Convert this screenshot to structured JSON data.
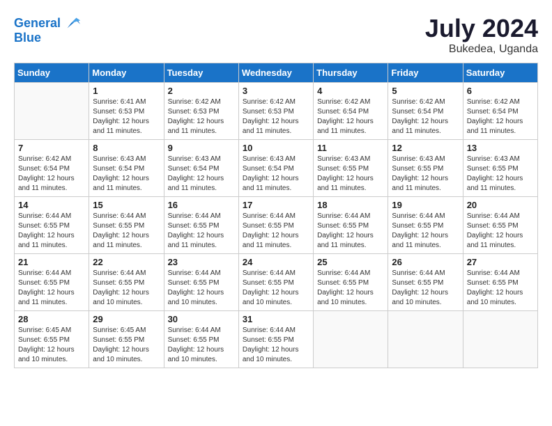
{
  "header": {
    "logo_line1": "General",
    "logo_line2": "Blue",
    "month_year": "July 2024",
    "location": "Bukedea, Uganda"
  },
  "weekdays": [
    "Sunday",
    "Monday",
    "Tuesday",
    "Wednesday",
    "Thursday",
    "Friday",
    "Saturday"
  ],
  "weeks": [
    [
      {
        "day": "",
        "sunrise": "",
        "sunset": "",
        "daylight": ""
      },
      {
        "day": "1",
        "sunrise": "Sunrise: 6:41 AM",
        "sunset": "Sunset: 6:53 PM",
        "daylight": "Daylight: 12 hours and 11 minutes."
      },
      {
        "day": "2",
        "sunrise": "Sunrise: 6:42 AM",
        "sunset": "Sunset: 6:53 PM",
        "daylight": "Daylight: 12 hours and 11 minutes."
      },
      {
        "day": "3",
        "sunrise": "Sunrise: 6:42 AM",
        "sunset": "Sunset: 6:53 PM",
        "daylight": "Daylight: 12 hours and 11 minutes."
      },
      {
        "day": "4",
        "sunrise": "Sunrise: 6:42 AM",
        "sunset": "Sunset: 6:54 PM",
        "daylight": "Daylight: 12 hours and 11 minutes."
      },
      {
        "day": "5",
        "sunrise": "Sunrise: 6:42 AM",
        "sunset": "Sunset: 6:54 PM",
        "daylight": "Daylight: 12 hours and 11 minutes."
      },
      {
        "day": "6",
        "sunrise": "Sunrise: 6:42 AM",
        "sunset": "Sunset: 6:54 PM",
        "daylight": "Daylight: 12 hours and 11 minutes."
      }
    ],
    [
      {
        "day": "7",
        "sunrise": "Sunrise: 6:42 AM",
        "sunset": "Sunset: 6:54 PM",
        "daylight": "Daylight: 12 hours and 11 minutes."
      },
      {
        "day": "8",
        "sunrise": "Sunrise: 6:43 AM",
        "sunset": "Sunset: 6:54 PM",
        "daylight": "Daylight: 12 hours and 11 minutes."
      },
      {
        "day": "9",
        "sunrise": "Sunrise: 6:43 AM",
        "sunset": "Sunset: 6:54 PM",
        "daylight": "Daylight: 12 hours and 11 minutes."
      },
      {
        "day": "10",
        "sunrise": "Sunrise: 6:43 AM",
        "sunset": "Sunset: 6:54 PM",
        "daylight": "Daylight: 12 hours and 11 minutes."
      },
      {
        "day": "11",
        "sunrise": "Sunrise: 6:43 AM",
        "sunset": "Sunset: 6:55 PM",
        "daylight": "Daylight: 12 hours and 11 minutes."
      },
      {
        "day": "12",
        "sunrise": "Sunrise: 6:43 AM",
        "sunset": "Sunset: 6:55 PM",
        "daylight": "Daylight: 12 hours and 11 minutes."
      },
      {
        "day": "13",
        "sunrise": "Sunrise: 6:43 AM",
        "sunset": "Sunset: 6:55 PM",
        "daylight": "Daylight: 12 hours and 11 minutes."
      }
    ],
    [
      {
        "day": "14",
        "sunrise": "Sunrise: 6:44 AM",
        "sunset": "Sunset: 6:55 PM",
        "daylight": "Daylight: 12 hours and 11 minutes."
      },
      {
        "day": "15",
        "sunrise": "Sunrise: 6:44 AM",
        "sunset": "Sunset: 6:55 PM",
        "daylight": "Daylight: 12 hours and 11 minutes."
      },
      {
        "day": "16",
        "sunrise": "Sunrise: 6:44 AM",
        "sunset": "Sunset: 6:55 PM",
        "daylight": "Daylight: 12 hours and 11 minutes."
      },
      {
        "day": "17",
        "sunrise": "Sunrise: 6:44 AM",
        "sunset": "Sunset: 6:55 PM",
        "daylight": "Daylight: 12 hours and 11 minutes."
      },
      {
        "day": "18",
        "sunrise": "Sunrise: 6:44 AM",
        "sunset": "Sunset: 6:55 PM",
        "daylight": "Daylight: 12 hours and 11 minutes."
      },
      {
        "day": "19",
        "sunrise": "Sunrise: 6:44 AM",
        "sunset": "Sunset: 6:55 PM",
        "daylight": "Daylight: 12 hours and 11 minutes."
      },
      {
        "day": "20",
        "sunrise": "Sunrise: 6:44 AM",
        "sunset": "Sunset: 6:55 PM",
        "daylight": "Daylight: 12 hours and 11 minutes."
      }
    ],
    [
      {
        "day": "21",
        "sunrise": "Sunrise: 6:44 AM",
        "sunset": "Sunset: 6:55 PM",
        "daylight": "Daylight: 12 hours and 11 minutes."
      },
      {
        "day": "22",
        "sunrise": "Sunrise: 6:44 AM",
        "sunset": "Sunset: 6:55 PM",
        "daylight": "Daylight: 12 hours and 10 minutes."
      },
      {
        "day": "23",
        "sunrise": "Sunrise: 6:44 AM",
        "sunset": "Sunset: 6:55 PM",
        "daylight": "Daylight: 12 hours and 10 minutes."
      },
      {
        "day": "24",
        "sunrise": "Sunrise: 6:44 AM",
        "sunset": "Sunset: 6:55 PM",
        "daylight": "Daylight: 12 hours and 10 minutes."
      },
      {
        "day": "25",
        "sunrise": "Sunrise: 6:44 AM",
        "sunset": "Sunset: 6:55 PM",
        "daylight": "Daylight: 12 hours and 10 minutes."
      },
      {
        "day": "26",
        "sunrise": "Sunrise: 6:44 AM",
        "sunset": "Sunset: 6:55 PM",
        "daylight": "Daylight: 12 hours and 10 minutes."
      },
      {
        "day": "27",
        "sunrise": "Sunrise: 6:44 AM",
        "sunset": "Sunset: 6:55 PM",
        "daylight": "Daylight: 12 hours and 10 minutes."
      }
    ],
    [
      {
        "day": "28",
        "sunrise": "Sunrise: 6:45 AM",
        "sunset": "Sunset: 6:55 PM",
        "daylight": "Daylight: 12 hours and 10 minutes."
      },
      {
        "day": "29",
        "sunrise": "Sunrise: 6:45 AM",
        "sunset": "Sunset: 6:55 PM",
        "daylight": "Daylight: 12 hours and 10 minutes."
      },
      {
        "day": "30",
        "sunrise": "Sunrise: 6:44 AM",
        "sunset": "Sunset: 6:55 PM",
        "daylight": "Daylight: 12 hours and 10 minutes."
      },
      {
        "day": "31",
        "sunrise": "Sunrise: 6:44 AM",
        "sunset": "Sunset: 6:55 PM",
        "daylight": "Daylight: 12 hours and 10 minutes."
      },
      {
        "day": "",
        "sunrise": "",
        "sunset": "",
        "daylight": ""
      },
      {
        "day": "",
        "sunrise": "",
        "sunset": "",
        "daylight": ""
      },
      {
        "day": "",
        "sunrise": "",
        "sunset": "",
        "daylight": ""
      }
    ]
  ]
}
